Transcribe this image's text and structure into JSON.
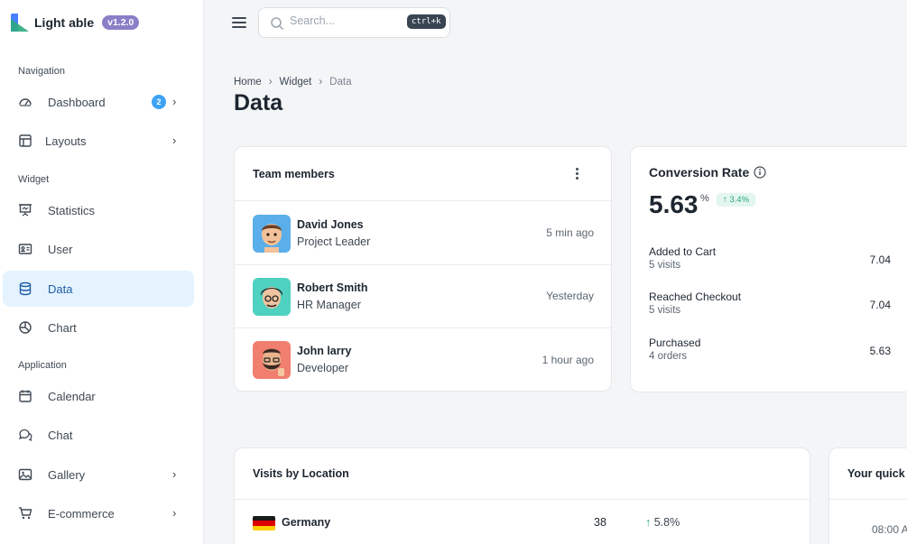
{
  "brand": {
    "name": "Light able",
    "version": "v1.2.0"
  },
  "nav": {
    "captions": [
      "Navigation",
      "Widget",
      "Application"
    ],
    "items": [
      {
        "label": "Dashboard",
        "icon": "dashboard-icon",
        "badge": "2",
        "chevron": "›"
      },
      {
        "label": "Layouts",
        "icon": "layout-icon",
        "chevron": "›"
      },
      {
        "label": "Statistics",
        "icon": "presentation-icon"
      },
      {
        "label": "User",
        "icon": "user-card-icon"
      },
      {
        "label": "Data",
        "icon": "database-icon",
        "active": true
      },
      {
        "label": "Chart",
        "icon": "pie-chart-icon"
      },
      {
        "label": "Calendar",
        "icon": "calendar-icon"
      },
      {
        "label": "Chat",
        "icon": "chat-icon"
      },
      {
        "label": "Gallery",
        "icon": "gallery-icon",
        "chevron": "›"
      },
      {
        "label": "E-commerce",
        "icon": "cart-icon",
        "chevron": "›"
      }
    ]
  },
  "header": {
    "search": {
      "placeholder": "Search...",
      "shortcut": "ctrl+k"
    }
  },
  "breadcrumb": {
    "items": [
      "Home",
      "Widget",
      "Data"
    ],
    "separator": "›"
  },
  "page": {
    "title": "Data"
  },
  "team": {
    "title": "Team members",
    "members": [
      {
        "name": "David Jones",
        "role": "Project Leader",
        "time": "5 min ago"
      },
      {
        "name": "Robert Smith",
        "role": "HR Manager",
        "time": "Yesterday"
      },
      {
        "name": "John larry",
        "role": "Developer",
        "time": "1 hour ago"
      }
    ]
  },
  "conversion": {
    "title": "Conversion Rate",
    "value": "5.63",
    "unit": "%",
    "change": "↑ 3.4%",
    "rows": [
      {
        "label": "Added to Cart",
        "sub": "5 visits",
        "value": "7.04"
      },
      {
        "label": "Reached Checkout",
        "sub": "5 visits",
        "value": "7.04"
      },
      {
        "label": "Purchased",
        "sub": "4 orders",
        "value": "5.63"
      }
    ]
  },
  "locations": {
    "title": "Visits by Location",
    "rows": [
      {
        "country": "Germany",
        "count": "38",
        "arrow": "↑",
        "change": "5.8%"
      }
    ]
  },
  "quick": {
    "title": "Your quick s",
    "time": "08:00 A"
  },
  "colors": {
    "primary": "#4680ff",
    "success": "#2ca87f",
    "active_bg": "#e5f3fe",
    "badge": "#3ea2f5"
  }
}
